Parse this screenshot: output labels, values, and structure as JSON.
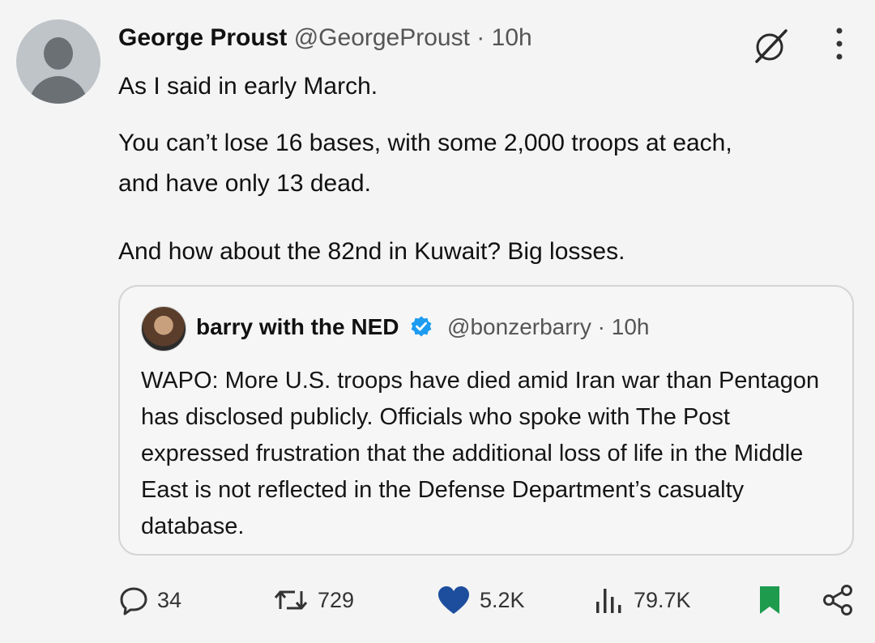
{
  "author": {
    "name": "George Proust",
    "handle": "@GeorgeProust",
    "separator": "·",
    "time": "10h"
  },
  "post": {
    "paragraph1": "As I said in early March.",
    "paragraph2": "You can’t lose 16 bases, with some 2,000 troops at each, and have only 13 dead.",
    "paragraph3": "And how about the 82nd in Kuwait?  Big losses."
  },
  "quoted": {
    "name": "barry with the NED",
    "handle": "@bonzerbarry",
    "separator": "·",
    "time": "10h",
    "text": "WAPO: More U.S. troops have died amid Iran war than Pentagon has disclosed publicly. Officials who spoke with The Post expressed frustration that the additional loss of life in the Middle East is not reflected in the Defense Department’s casualty database."
  },
  "actions": {
    "replies": "34",
    "reposts": "729",
    "likes": "5.2K",
    "views": "79.7K"
  },
  "colors": {
    "like": "#1d4e9e",
    "bookmark": "#1f9b4e",
    "verified": "#1d9bf0"
  },
  "icons": {
    "reply": "reply-icon",
    "repost": "repost-icon",
    "like": "heart-icon",
    "views": "views-icon",
    "bookmark": "bookmark-icon",
    "share": "share-icon",
    "grok": "grok-icon",
    "more": "more-icon",
    "verified": "verified-icon"
  }
}
